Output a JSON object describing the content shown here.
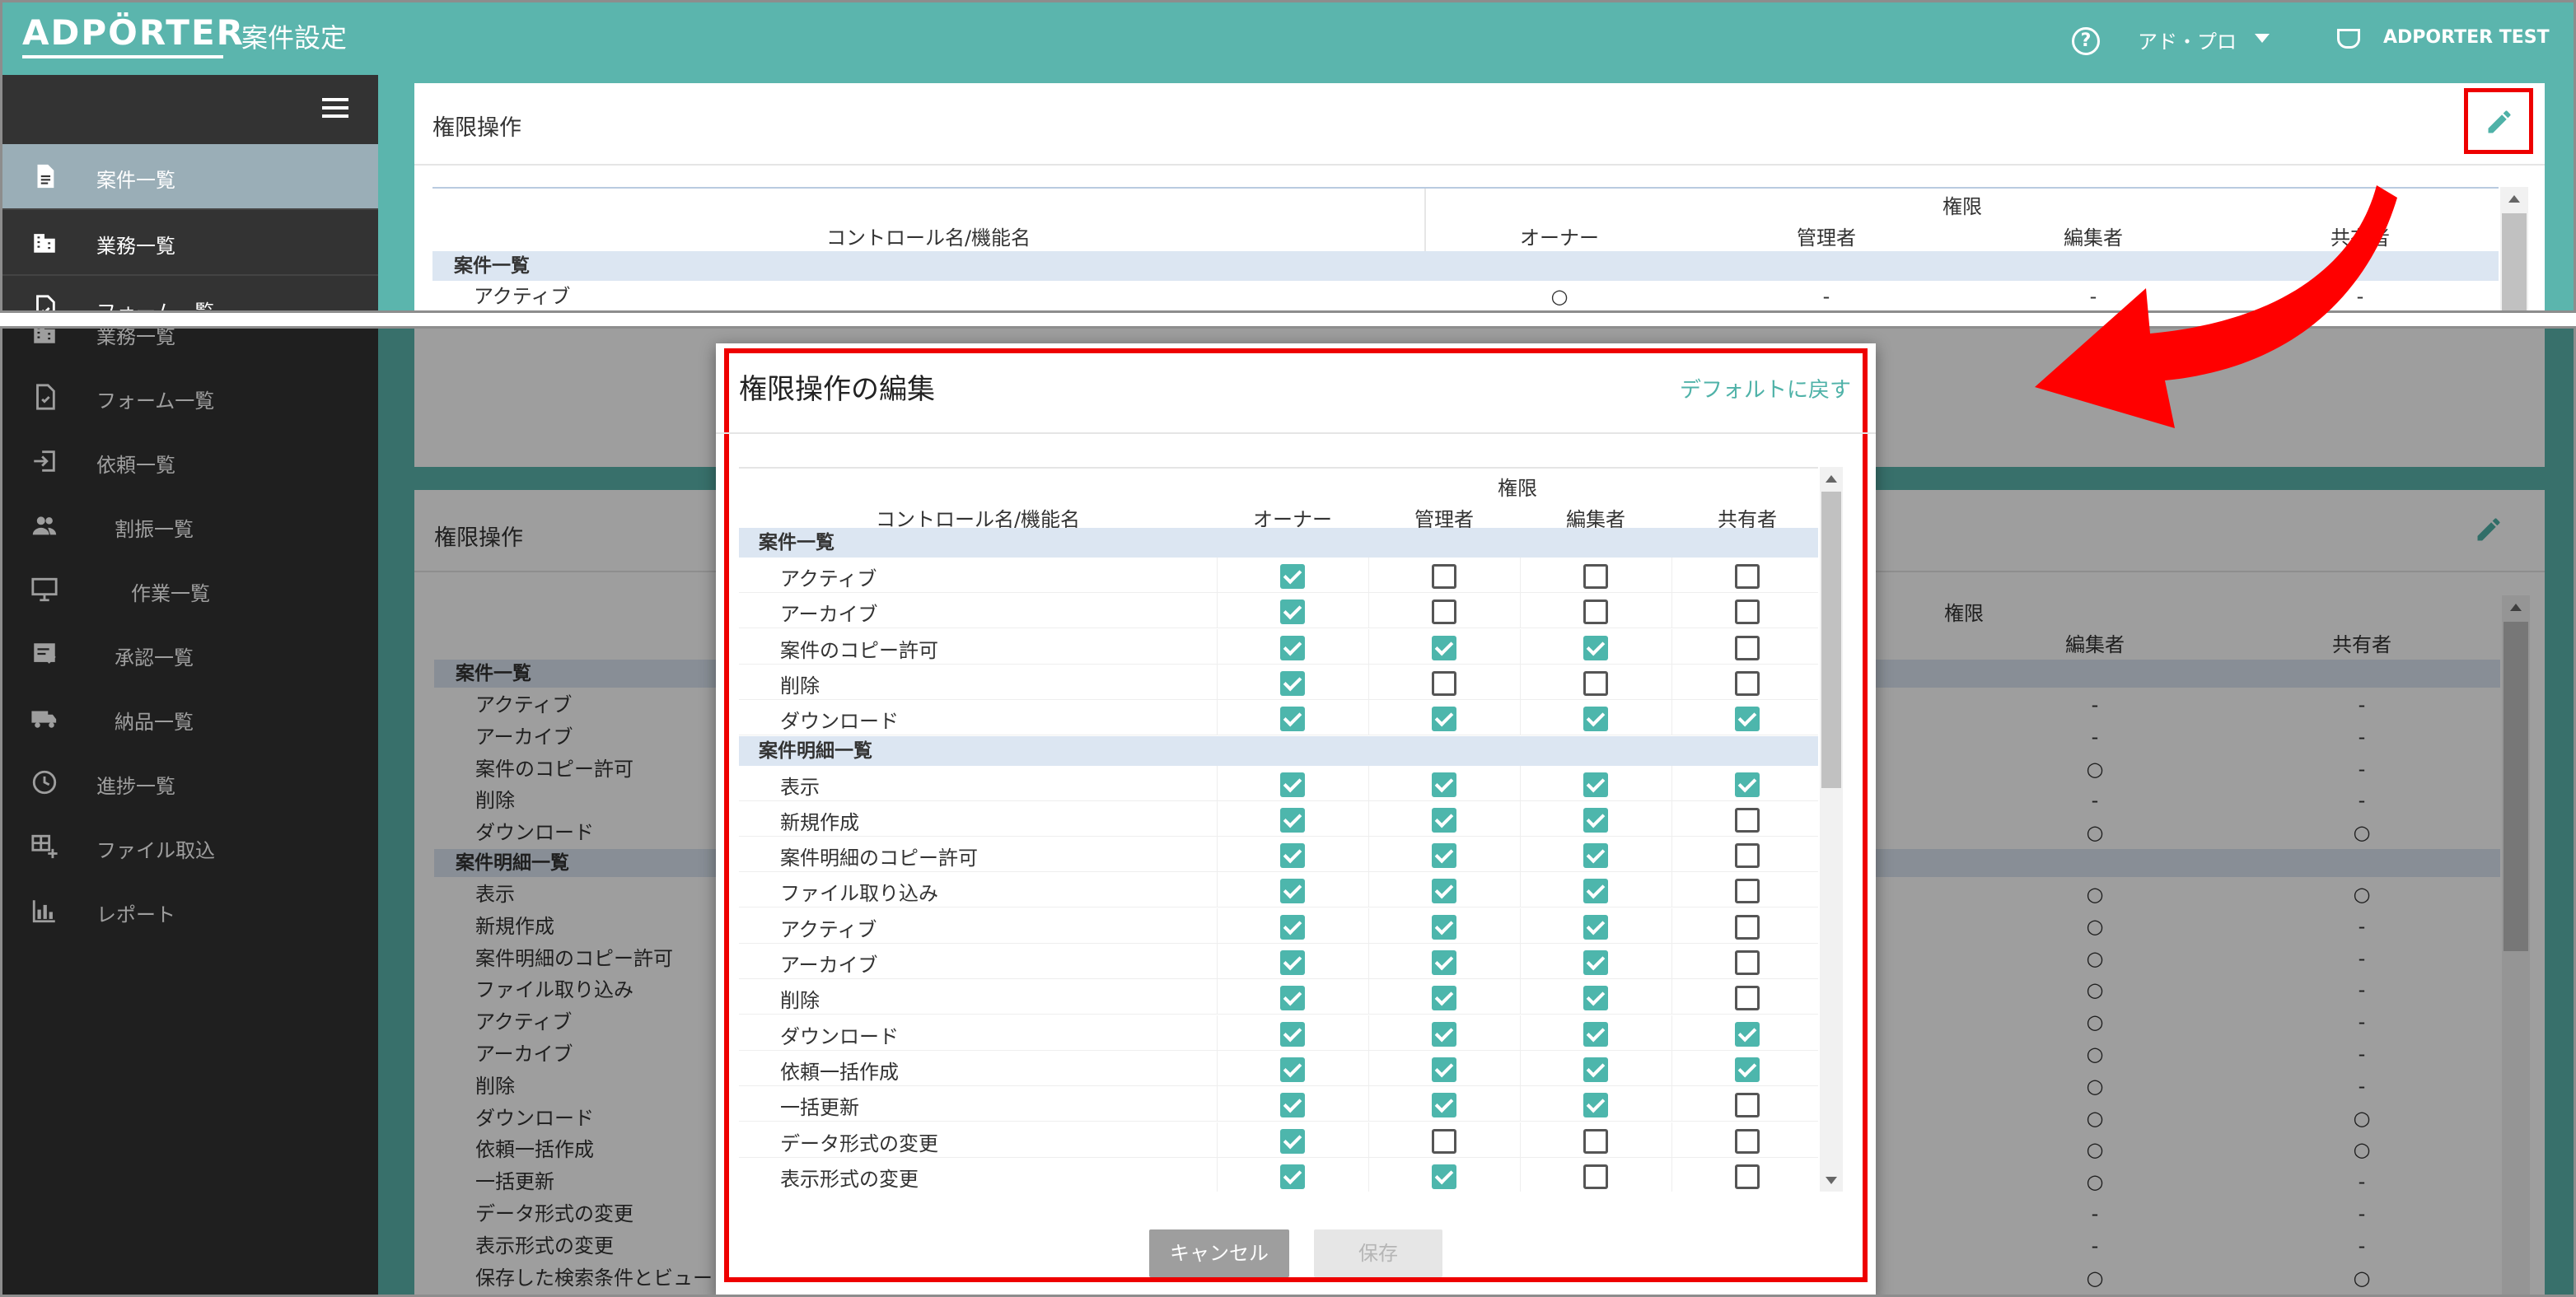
{
  "header": {
    "logo": "ADPÖRTER",
    "title": "案件設定",
    "user_menu": "アド・プロ",
    "account": "ADPORTER TEST"
  },
  "colors": {
    "brand": "#5bb5ad",
    "sidebar": "#333333",
    "checked": "#4db6ac",
    "highlight": "#ee0000"
  },
  "sidebar_top": [
    {
      "label": "案件一覧",
      "icon": "document-icon",
      "active": true
    },
    {
      "label": "業務一覧",
      "icon": "building-icon"
    },
    {
      "label": "フォーム一覧",
      "icon": "form-icon"
    }
  ],
  "sidebar_bottom": [
    {
      "label": "業務一覧",
      "icon": "building-icon"
    },
    {
      "label": "フォーム一覧",
      "icon": "form-icon"
    },
    {
      "label": "依頼一覧",
      "icon": "login-icon"
    },
    {
      "label": "割振一覧",
      "icon": "people-icon"
    },
    {
      "label": "作業一覧",
      "icon": "monitor-icon"
    },
    {
      "label": "承認一覧",
      "icon": "approval-icon"
    },
    {
      "label": "納品一覧",
      "icon": "truck-icon"
    },
    {
      "label": "進捗一覧",
      "icon": "history-icon"
    },
    {
      "label": "ファイル取込",
      "icon": "table-add-icon"
    },
    {
      "label": "レポート",
      "icon": "bar-chart-icon"
    }
  ],
  "top_card": {
    "title": "権限操作",
    "table": {
      "col_control": "コントロール名/機能名",
      "group": "権限",
      "roles": [
        "オーナー",
        "管理者",
        "編集者",
        "共有者"
      ],
      "section": "案件一覧",
      "first_row": {
        "name": "アクティブ",
        "values": [
          "○",
          "-",
          "-",
          "-"
        ]
      }
    }
  },
  "bottom_card": {
    "title": "権限操作",
    "group": "権限",
    "visible_roles": [
      "編集者",
      "共有者"
    ],
    "sections": [
      {
        "label": "案件一覧",
        "rows": [
          {
            "name": "アクティブ",
            "editor": "-",
            "sharer": "-"
          },
          {
            "name": "アーカイブ",
            "editor": "-",
            "sharer": "-"
          },
          {
            "name": "案件のコピー許可",
            "editor": "○",
            "sharer": "-"
          },
          {
            "name": "削除",
            "editor": "-",
            "sharer": "-"
          },
          {
            "name": "ダウンロード",
            "editor": "○",
            "sharer": "○"
          }
        ]
      },
      {
        "label": "案件明細一覧",
        "rows": [
          {
            "name": "表示",
            "editor": "○",
            "sharer": "○"
          },
          {
            "name": "新規作成",
            "editor": "○",
            "sharer": "-"
          },
          {
            "name": "案件明細のコピー許可",
            "editor": "○",
            "sharer": "-"
          },
          {
            "name": "ファイル取り込み",
            "editor": "○",
            "sharer": "-"
          },
          {
            "name": "アクティブ",
            "editor": "○",
            "sharer": "-"
          },
          {
            "name": "アーカイブ",
            "editor": "○",
            "sharer": "-"
          },
          {
            "name": "削除",
            "editor": "○",
            "sharer": "-"
          },
          {
            "name": "ダウンロード",
            "editor": "○",
            "sharer": "○"
          },
          {
            "name": "依頼一括作成",
            "editor": "○",
            "sharer": "○"
          },
          {
            "name": "一括更新",
            "editor": "○",
            "sharer": "-"
          },
          {
            "name": "データ形式の変更",
            "editor": "-",
            "sharer": "-"
          },
          {
            "name": "表示形式の変更",
            "editor": "-",
            "sharer": "-"
          },
          {
            "name": "保存した検索条件とビュー",
            "editor": "○",
            "sharer": "○"
          }
        ]
      }
    ]
  },
  "modal": {
    "title": "権限操作の編集",
    "reset_link": "デフォルトに戻す",
    "col_control": "コントロール名/機能名",
    "group": "権限",
    "roles": [
      "オーナー",
      "管理者",
      "編集者",
      "共有者"
    ],
    "sections": [
      {
        "label": "案件一覧",
        "rows": [
          {
            "name": "アクティブ",
            "checks": [
              true,
              false,
              false,
              false
            ]
          },
          {
            "name": "アーカイブ",
            "checks": [
              true,
              false,
              false,
              false
            ]
          },
          {
            "name": "案件のコピー許可",
            "checks": [
              true,
              true,
              true,
              false
            ]
          },
          {
            "name": "削除",
            "checks": [
              true,
              false,
              false,
              false
            ]
          },
          {
            "name": "ダウンロード",
            "checks": [
              true,
              true,
              true,
              true
            ]
          }
        ]
      },
      {
        "label": "案件明細一覧",
        "rows": [
          {
            "name": "表示",
            "checks": [
              true,
              true,
              true,
              true
            ]
          },
          {
            "name": "新規作成",
            "checks": [
              true,
              true,
              true,
              false
            ]
          },
          {
            "name": "案件明細のコピー許可",
            "checks": [
              true,
              true,
              true,
              false
            ]
          },
          {
            "name": "ファイル取り込み",
            "checks": [
              true,
              true,
              true,
              false
            ]
          },
          {
            "name": "アクティブ",
            "checks": [
              true,
              true,
              true,
              false
            ]
          },
          {
            "name": "アーカイブ",
            "checks": [
              true,
              true,
              true,
              false
            ]
          },
          {
            "name": "削除",
            "checks": [
              true,
              true,
              true,
              false
            ]
          },
          {
            "name": "ダウンロード",
            "checks": [
              true,
              true,
              true,
              true
            ]
          },
          {
            "name": "依頼一括作成",
            "checks": [
              true,
              true,
              true,
              true
            ]
          },
          {
            "name": "一括更新",
            "checks": [
              true,
              true,
              true,
              false
            ]
          },
          {
            "name": "データ形式の変更",
            "checks": [
              true,
              false,
              false,
              false
            ]
          },
          {
            "name": "表示形式の変更",
            "checks": [
              true,
              true,
              false,
              false
            ]
          }
        ]
      }
    ],
    "cancel_label": "キャンセル",
    "save_label": "保存"
  }
}
